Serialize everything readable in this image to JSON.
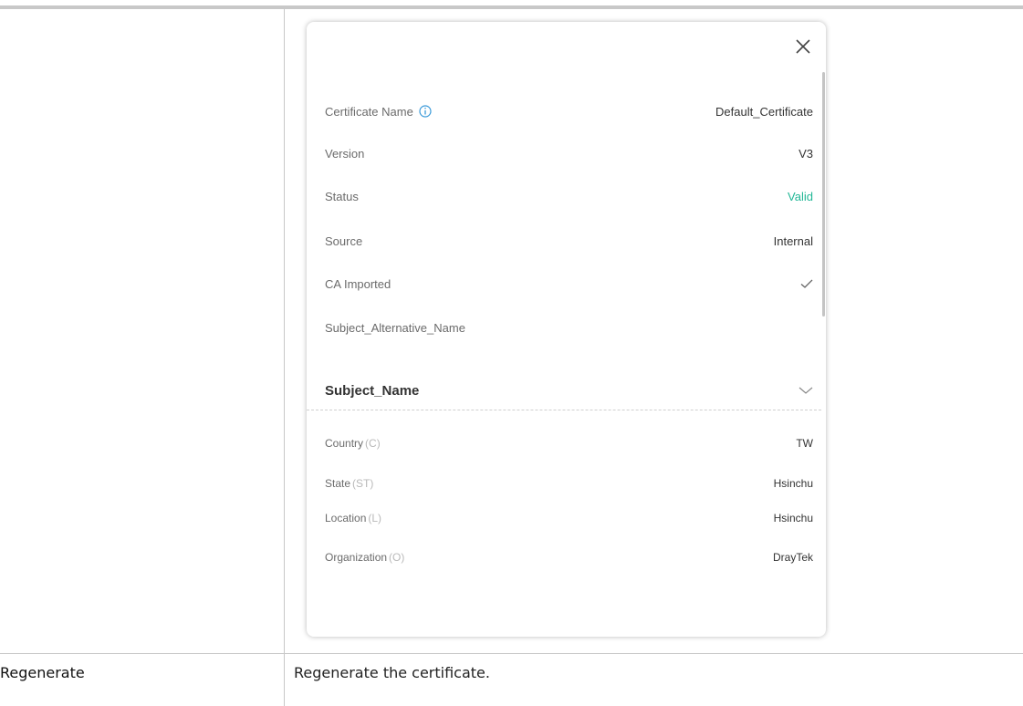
{
  "certificate": {
    "name_label": "Certificate Name",
    "name_value": "Default_Certificate",
    "version_label": "Version",
    "version_value": "V3",
    "status_label": "Status",
    "status_value": "Valid",
    "source_label": "Source",
    "source_value": "Internal",
    "ca_imported_label": "CA Imported",
    "san_label": "Subject_Alternative_Name"
  },
  "subject_name": {
    "title": "Subject_Name",
    "fields": [
      {
        "label": "Country",
        "code": "(C)",
        "value": "TW"
      },
      {
        "label": "State",
        "code": "(ST)",
        "value": "Hsinchu"
      },
      {
        "label": "Location",
        "code": "(L)",
        "value": "Hsinchu"
      },
      {
        "label": "Organization",
        "code": "(O)",
        "value": "DrayTek"
      }
    ]
  },
  "table_row": {
    "label": "Regenerate",
    "description": "Regenerate the certificate."
  },
  "colors": {
    "valid": "#22b796",
    "info_icon": "#3a9ad9"
  },
  "icons": {
    "close": "close-icon",
    "info": "info-icon",
    "check": "checkmark-icon",
    "chevron": "chevron-down-icon"
  }
}
